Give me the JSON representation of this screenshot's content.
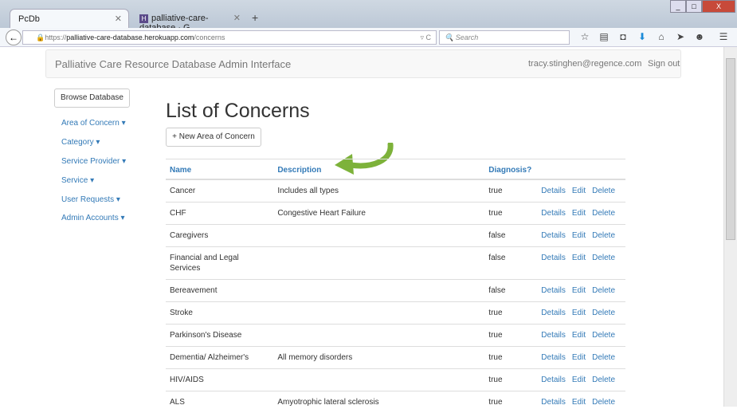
{
  "browser": {
    "tabs": [
      {
        "label": "PcDb"
      },
      {
        "label": "palliative-care-database · G..."
      }
    ],
    "url_prefix": "https://",
    "url_host": "palliative-care-database.herokuapp.com",
    "url_path": "/concerns",
    "search_placeholder": "Search"
  },
  "app": {
    "brand": "Palliative Care Resource Database Admin Interface",
    "user_email": "tracy.stinghen@regence.com",
    "sign_out": "Sign out"
  },
  "sidebar": {
    "browse": "Browse Database",
    "items": [
      {
        "label": "Area of Concern ▾"
      },
      {
        "label": "Category ▾"
      },
      {
        "label": "Service Provider ▾"
      },
      {
        "label": "Service ▾"
      },
      {
        "label": "User Requests ▾"
      },
      {
        "label": "Admin Accounts ▾"
      }
    ]
  },
  "main": {
    "title": "List of Concerns",
    "new_button": "+ New Area of Concern",
    "columns": [
      "Name",
      "Description",
      "Diagnosis?"
    ],
    "actions": [
      "Details",
      "Edit",
      "Delete"
    ],
    "rows": [
      {
        "name": "Cancer",
        "description": "Includes all types",
        "diagnosis": "true"
      },
      {
        "name": "CHF",
        "description": "Congestive Heart Failure",
        "diagnosis": "true"
      },
      {
        "name": "Caregivers",
        "description": "",
        "diagnosis": "false"
      },
      {
        "name": "Financial and Legal Services",
        "description": "",
        "diagnosis": "false"
      },
      {
        "name": "Bereavement",
        "description": "",
        "diagnosis": "false"
      },
      {
        "name": "Stroke",
        "description": "",
        "diagnosis": "true"
      },
      {
        "name": "Parkinson's Disease",
        "description": "",
        "diagnosis": "true"
      },
      {
        "name": "Dementia/ Alzheimer's",
        "description": "All memory disorders",
        "diagnosis": "true"
      },
      {
        "name": "HIV/AIDS",
        "description": "",
        "diagnosis": "true"
      },
      {
        "name": "ALS",
        "description": "Amyotrophic lateral sclerosis",
        "diagnosis": "true"
      }
    ]
  },
  "colors": {
    "link": "#337ab7",
    "arrow": "#7db23a"
  }
}
